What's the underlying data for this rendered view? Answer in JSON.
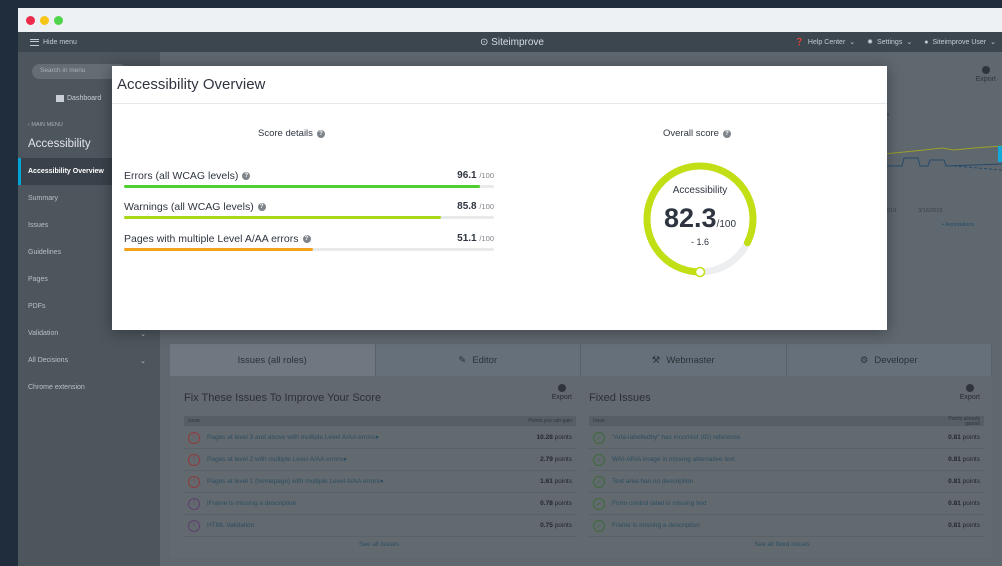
{
  "topbar": {
    "hide_menu": "Hide menu",
    "brand": "Siteimprove",
    "help_center": "Help Center",
    "settings": "Settings",
    "user": "Siteimprove User"
  },
  "sidebar": {
    "search_placeholder": "Search in menu",
    "dashboard": "Dashboard",
    "main_menu": "MAIN MENU",
    "section_title": "Accessibility",
    "items": [
      {
        "label": "Accessibility Overview"
      },
      {
        "label": "Summary"
      },
      {
        "label": "Issues"
      },
      {
        "label": "Guidelines"
      },
      {
        "label": "Pages"
      },
      {
        "label": "PDFs"
      },
      {
        "label": "Validation"
      },
      {
        "label": "All Decisions"
      },
      {
        "label": "Chrome extension"
      }
    ]
  },
  "background": {
    "export_label": "Export",
    "chart_dates": [
      "2019",
      "3/15/2019"
    ],
    "annotations": "Annotations",
    "partial_label": "ss"
  },
  "tabs": [
    {
      "label": "Issues (all roles)",
      "icon": "none"
    },
    {
      "label": "Editor",
      "icon": "editor-icon"
    },
    {
      "label": "Webmaster",
      "icon": "webmaster-icon"
    },
    {
      "label": "Developer",
      "icon": "developer-icon"
    }
  ],
  "fix_issues": {
    "title": "Fix These Issues To Improve Your Score",
    "export": "Export",
    "col_issue": "Issue",
    "col_points": "Points you can gain",
    "rows": [
      {
        "text": "Pages at level 3 and above with multiple Level A/AA errors",
        "points": "10.28",
        "unit": "points"
      },
      {
        "text": "Pages at level 2 with multiple Level A/AA errors",
        "points": "2.79",
        "unit": "points"
      },
      {
        "text": "Pages at level 1 (homepage) with multiple Level A/AA errors",
        "points": "1.61",
        "unit": "points"
      },
      {
        "text": "iFrame is missing a description",
        "points": "0.78",
        "unit": "points"
      },
      {
        "text": "HTML Validation",
        "points": "0.75",
        "unit": "points"
      }
    ],
    "see_all": "See all issues"
  },
  "fixed_issues": {
    "title": "Fixed Issues",
    "export": "Export",
    "col_issue": "Issue",
    "col_points": "Points already gained",
    "rows": [
      {
        "text": "\"Aria-labelledby\" has incorrect (ID) reference",
        "points": "0.81",
        "unit": "points"
      },
      {
        "text": "WAI-ARIA image is missing alternative text",
        "points": "0.81",
        "unit": "points"
      },
      {
        "text": "Text area has no description",
        "points": "0.81",
        "unit": "points"
      },
      {
        "text": "Form control label is missing text",
        "points": "0.81",
        "unit": "points"
      },
      {
        "text": "Frame is missing a description",
        "points": "0.81",
        "unit": "points"
      }
    ],
    "see_all": "See all fixed issues"
  },
  "modal": {
    "title": "Accessibility Overview",
    "score_details_title": "Score details",
    "overall_score_title": "Overall score",
    "scores": [
      {
        "label": "Errors (all WCAG levels)",
        "value": "96.1",
        "max": "/100",
        "fraction": 0.961,
        "color": "#4fcf31"
      },
      {
        "label": "Warnings (all WCAG levels)",
        "value": "85.8",
        "max": "/100",
        "fraction": 0.858,
        "color": "#a6d817"
      },
      {
        "label": "Pages with multiple Level A/AA errors",
        "value": "51.1",
        "max": "/100",
        "fraction": 0.511,
        "color": "#f3a21c"
      }
    ],
    "overall": {
      "label": "Accessibility",
      "value": "82.3",
      "max": "/100",
      "change": "- 1.6",
      "fraction": 0.823,
      "color": "#c2df15"
    }
  }
}
